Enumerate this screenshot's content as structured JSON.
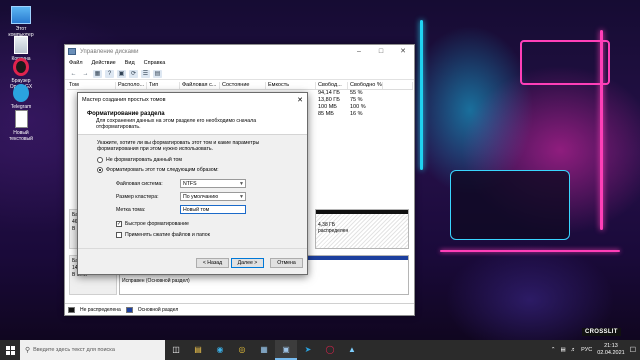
{
  "desktop": {
    "icons": [
      {
        "label": "Этот компьютер",
        "icon": "computer-icon"
      },
      {
        "label": "Корзина",
        "icon": "recycle-bin-icon"
      },
      {
        "label": "Браузер Opera GX",
        "icon": "opera-gx-icon"
      },
      {
        "label": "Telegram",
        "icon": "telegram-icon"
      },
      {
        "label": "Новый текстовый",
        "icon": "text-file-icon"
      }
    ],
    "watermark": "CROSSLIT"
  },
  "disk_mgmt": {
    "title": "Управление дисками",
    "menu": [
      "Файл",
      "Действие",
      "Вид",
      "Справка"
    ],
    "columns": [
      "Том",
      "Располо...",
      "Тип",
      "Файловая с...",
      "Состояние",
      "Емкость",
      "Свобод...",
      "Свободно %"
    ],
    "rows": [
      {
        "free": "94,14 ГБ",
        "pct": "55 %"
      },
      {
        "free": "13,80 ГБ",
        "pct": "75 %"
      },
      {
        "free": "100 МБ",
        "pct": "100 %"
      },
      {
        "free": "85 МБ",
        "pct": "16 %"
      }
    ],
    "disk0": {
      "name": "Ба",
      "size": "46",
      "status": "В"
    },
    "disk1": {
      "name": "Ба",
      "size": "14",
      "status": "В сети"
    },
    "partition_size": "4,38 ГБ",
    "partition_status": "распределен",
    "partition_healthy": "Исправен (Основной раздел)",
    "legend": [
      "Не распределена",
      "Основной раздел"
    ]
  },
  "wizard": {
    "title": "Мастер создания простых томов",
    "heading": "Форматирование раздела",
    "subheading": "Для сохранения данных на этом разделе его необходимо сначала отформатировать.",
    "intro": "Укажите, хотите ли вы форматировать этот том и какие параметры форматирования при этом нужно использовать.",
    "opt_no_format": "Не форматировать данный том",
    "opt_format": "Форматировать этот том следующим образом:",
    "fs_label": "Файловая система:",
    "fs_value": "NTFS",
    "cluster_label": "Размер кластера:",
    "cluster_value": "По умолчанию",
    "volume_label_label": "Метка тома:",
    "volume_label_value": "Новый том",
    "quick_format": "Быстрое форматирование",
    "compression": "Применять сжатие файлов и папок",
    "btn_back": "< Назад",
    "btn_next": "Далее >",
    "btn_cancel": "Отмена"
  },
  "taskbar": {
    "search_placeholder": "Введите здесь текст для поиска",
    "lang": "РУС",
    "time": "21:13",
    "date": "02.04.2021"
  }
}
